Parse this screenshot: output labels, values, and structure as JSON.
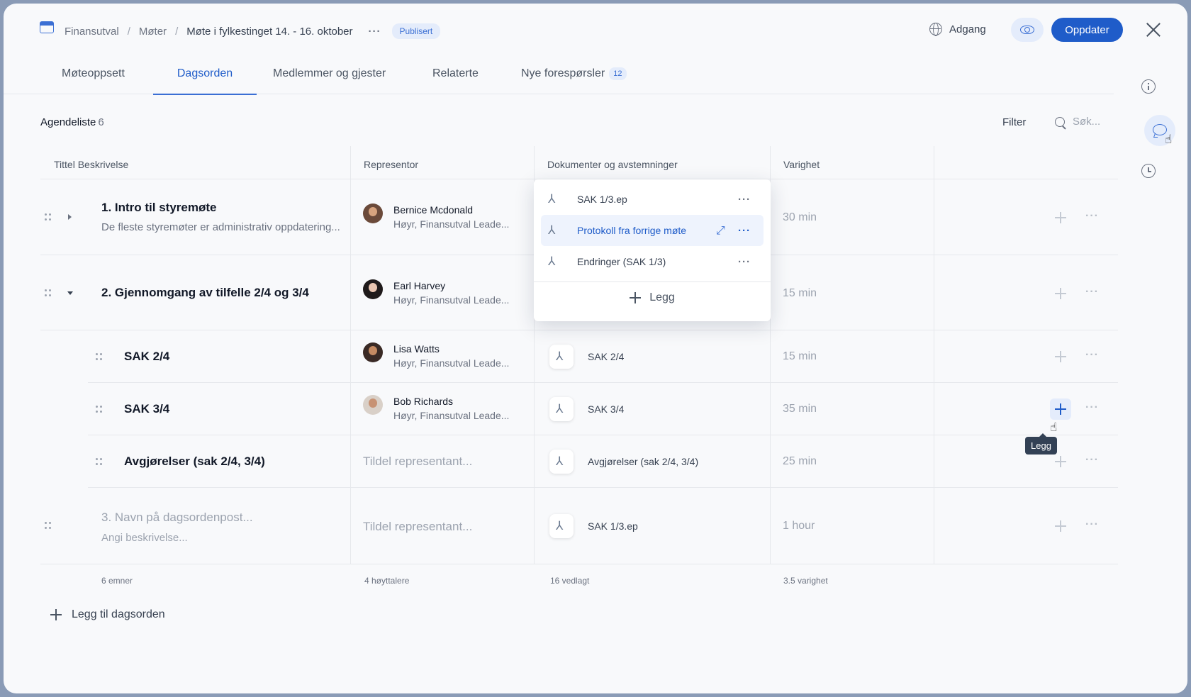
{
  "breadcrumb": {
    "app": "Finansutval",
    "sep1": "/",
    "section": "Møter",
    "sep2": "/",
    "current": "Møte i fylkestinget 14. - 16. oktober",
    "more": "···",
    "status": "Publisert"
  },
  "header": {
    "access_label": "Adgang",
    "update_label": "Oppdater"
  },
  "tabs": [
    {
      "label": "Møteoppsett"
    },
    {
      "label": "Dagsorden",
      "active": true
    },
    {
      "label": "Medlemmer og gjester"
    },
    {
      "label": "Relaterte"
    },
    {
      "label": "Nye forespørsler",
      "count": "12"
    }
  ],
  "toolbar": {
    "title": "Agendeliste",
    "count": "6",
    "filter_label": "Filter",
    "search_placeholder": "Søk..."
  },
  "columns": {
    "title": "Tittel Beskrivelse",
    "rep": "Representor",
    "docs": "Dokumenter og avstemninger",
    "duration": "Varighet"
  },
  "rows": [
    {
      "title": "1. Intro til styremøte",
      "desc": "De fleste styremøter er administrativ oppdatering...",
      "name": "Bernice Mcdonald",
      "role": "Høyr, Finansutval Leade...",
      "duration": "30 min"
    },
    {
      "title": "2. Gjennomgang av tilfelle 2/4 og 3/4",
      "name": "Earl Harvey",
      "role": "Høyr, Finansutval Leade...",
      "duration": "15 min"
    },
    {
      "title": "SAK 2/4",
      "name": "Lisa Watts",
      "role": "Høyr, Finansutval Leade...",
      "doc": "SAK 2/4",
      "duration": "15 min"
    },
    {
      "title": "SAK 3/4",
      "name": "Bob Richards",
      "role": "Høyr, Finansutval Leade...",
      "doc": "SAK 3/4",
      "duration": "35 min"
    },
    {
      "title": "Avgjørelser (sak 2/4, 3/4)",
      "assign": "Tildel representant...",
      "doc": "Avgjørelser (sak 2/4, 3/4)",
      "duration": "25 min"
    },
    {
      "title": "3. Navn på dagsordenpost...",
      "desc": "Angi beskrivelse...",
      "assign": "Tildel representant...",
      "doc": "SAK 1/3.ep",
      "duration": "1 hour"
    }
  ],
  "row_dots": "···",
  "footer": {
    "items": "6 emner",
    "speakers": "4 høyttalere",
    "attached": "16 vedlagt",
    "duration": "3.5 varighet"
  },
  "add_agenda_label": "Legg til dagsorden",
  "tooltip": "Legg",
  "popover": {
    "items": [
      {
        "label": "SAK 1/3.ep"
      },
      {
        "label": "Protokoll fra forrige møte",
        "highlighted": true
      },
      {
        "label": "Endringer (SAK 1/3)"
      }
    ],
    "dots": "···",
    "add_label": "Legg"
  },
  "icons": [
    "app-icon",
    "globe-icon",
    "eye-icon",
    "close-icon",
    "info-icon",
    "chat-icon",
    "history-icon",
    "search-icon",
    "drag-handle-icon",
    "pdf-icon",
    "plus-icon",
    "more-icon",
    "expand-icon",
    "cursor-icon"
  ],
  "colors": {
    "accent": "#1f5cc9",
    "accent_light": "#e4ecfb",
    "frame": "#8a9bb6"
  }
}
